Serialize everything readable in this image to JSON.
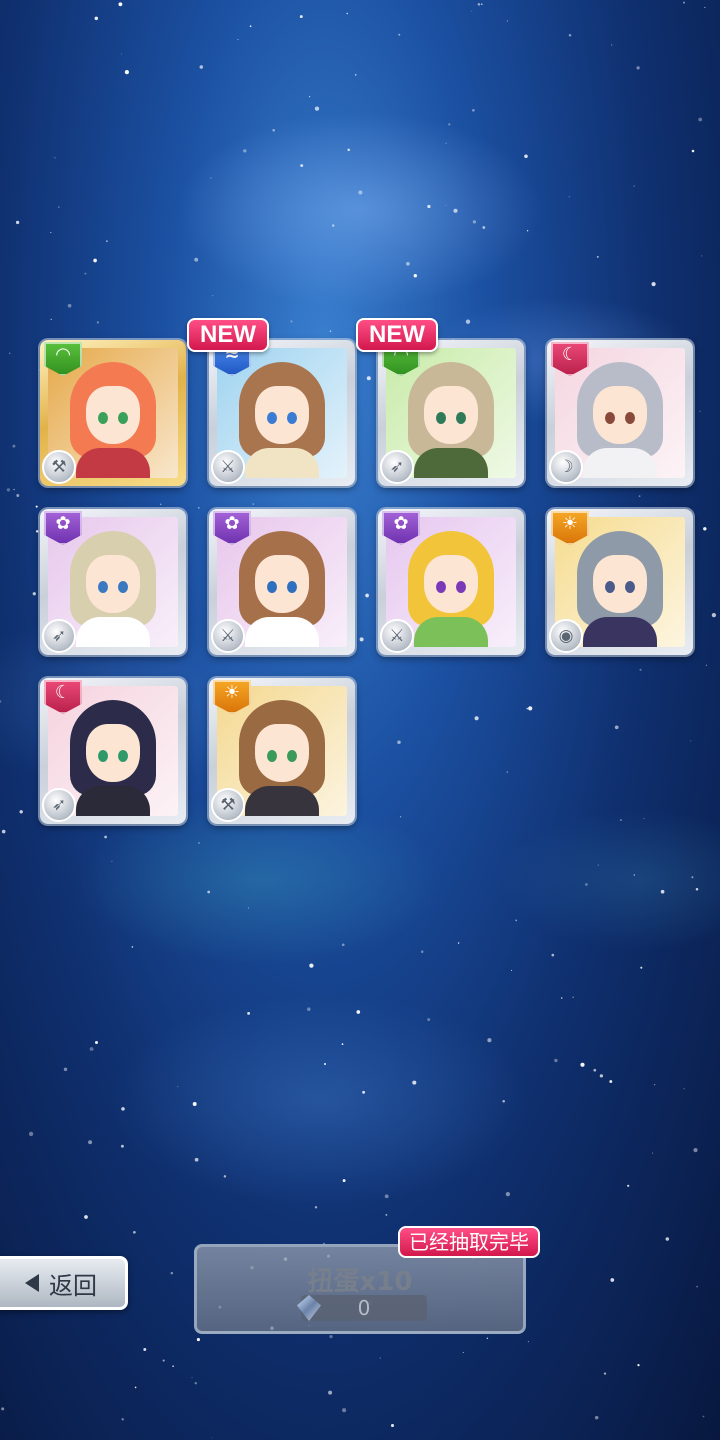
{
  "colors": {
    "new_badge": "#e0245e",
    "attr_green": "#3aa52a",
    "attr_blue": "#2e6fd8",
    "attr_pink": "#d82d5e",
    "attr_purple": "#8a44c4",
    "attr_orange": "#ee8d12"
  },
  "cards": [
    {
      "attr": "green",
      "attr_icon": "leaf-icon",
      "role_icon": "hammer-icon",
      "is_new": false,
      "new_label": "",
      "hair": "#f47a52",
      "bg": "#e6a94a",
      "eye": "#3aa05a",
      "outfit": "#c43a44"
    },
    {
      "attr": "blue",
      "attr_icon": "wave-icon",
      "role_icon": "sword-icon",
      "is_new": true,
      "new_label": "NEW",
      "hair": "#a8754e",
      "bg": "#9fd3f0",
      "eye": "#3a7bd4",
      "outfit": "#f1e4c4"
    },
    {
      "attr": "green",
      "attr_icon": "leaf-icon",
      "role_icon": "gun-icon",
      "is_new": true,
      "new_label": "NEW",
      "hair": "#c8b898",
      "bg": "#c8eba8",
      "eye": "#2f7a58",
      "outfit": "#4e6a3a"
    },
    {
      "attr": "pink",
      "attr_icon": "moon-icon",
      "role_icon": "scythe-icon",
      "is_new": false,
      "new_label": "",
      "hair": "#b7bcc8",
      "bg": "#f5d6e0",
      "eye": "#8a4a3a",
      "outfit": "#f2f2f4"
    },
    {
      "attr": "purple",
      "attr_icon": "flower-icon",
      "role_icon": "gun-icon",
      "is_new": false,
      "new_label": "",
      "hair": "#d8cfae",
      "bg": "#e7c8ec",
      "eye": "#3a78c0",
      "outfit": "#ffffff"
    },
    {
      "attr": "purple",
      "attr_icon": "flower-icon",
      "role_icon": "sword-icon",
      "is_new": false,
      "new_label": "",
      "hair": "#a6704a",
      "bg": "#e8c6ec",
      "eye": "#2f6fbf",
      "outfit": "#ffffff"
    },
    {
      "attr": "purple",
      "attr_icon": "flower-icon",
      "role_icon": "sword-icon",
      "is_new": false,
      "new_label": "",
      "hair": "#f2c43a",
      "bg": "#e6c7ef",
      "eye": "#7a3ab8",
      "outfit": "#7cc05a"
    },
    {
      "attr": "orange",
      "attr_icon": "sun-icon",
      "role_icon": "shield-icon",
      "is_new": false,
      "new_label": "",
      "hair": "#8e9aa8",
      "bg": "#f6dc90",
      "eye": "#4a5a8a",
      "outfit": "#3a3460"
    },
    {
      "attr": "pink",
      "attr_icon": "moon-icon",
      "role_icon": "gun-icon",
      "is_new": false,
      "new_label": "",
      "hair": "#2c2c4a",
      "bg": "#f5d3df",
      "eye": "#2e9a6a",
      "outfit": "#2a2a38"
    },
    {
      "attr": "orange",
      "attr_icon": "sun-icon",
      "role_icon": "hammer-icon",
      "is_new": false,
      "new_label": "",
      "hair": "#9a6a42",
      "bg": "#f4d890",
      "eye": "#3a9a5a",
      "outfit": "#38343e"
    }
  ],
  "back_button": {
    "label": "返回",
    "icon": "back-arrow-icon"
  },
  "gacha_button": {
    "label": "扭蛋x10",
    "count": "0",
    "icon": "gem-icon"
  },
  "status_badge": {
    "label": "已经抽取完毕"
  }
}
